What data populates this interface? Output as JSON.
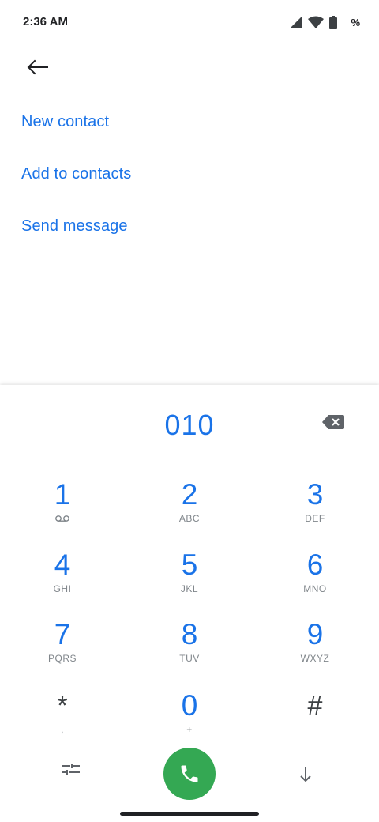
{
  "status_bar": {
    "time": "2:36 AM",
    "battery_text": "%",
    "icons": [
      "cell-signal-icon",
      "wifi-icon",
      "battery-icon"
    ]
  },
  "header": {
    "back_icon": "arrow-left-icon"
  },
  "actions": [
    {
      "label": "New contact"
    },
    {
      "label": "Add to contacts"
    },
    {
      "label": "Send message"
    }
  ],
  "dialpad": {
    "digits": "010",
    "backspace_icon": "backspace-icon",
    "keys": [
      {
        "num": "1",
        "sub": ""
      },
      {
        "num": "2",
        "sub": "ABC"
      },
      {
        "num": "3",
        "sub": "DEF"
      },
      {
        "num": "4",
        "sub": "GHI"
      },
      {
        "num": "5",
        "sub": "JKL"
      },
      {
        "num": "6",
        "sub": "MNO"
      },
      {
        "num": "7",
        "sub": "PQRS"
      },
      {
        "num": "8",
        "sub": "TUV"
      },
      {
        "num": "9",
        "sub": "WXYZ"
      },
      {
        "num": "*",
        "sub": ","
      },
      {
        "num": "0",
        "sub": "+"
      },
      {
        "num": "#",
        "sub": ""
      }
    ],
    "bottom_icons": [
      "settings-sliders-icon",
      "phone-icon",
      "arrow-down-icon"
    ]
  },
  "colors": {
    "accent": "#1a73e8",
    "call_button": "#34a853",
    "secondary_text": "#80868b"
  }
}
